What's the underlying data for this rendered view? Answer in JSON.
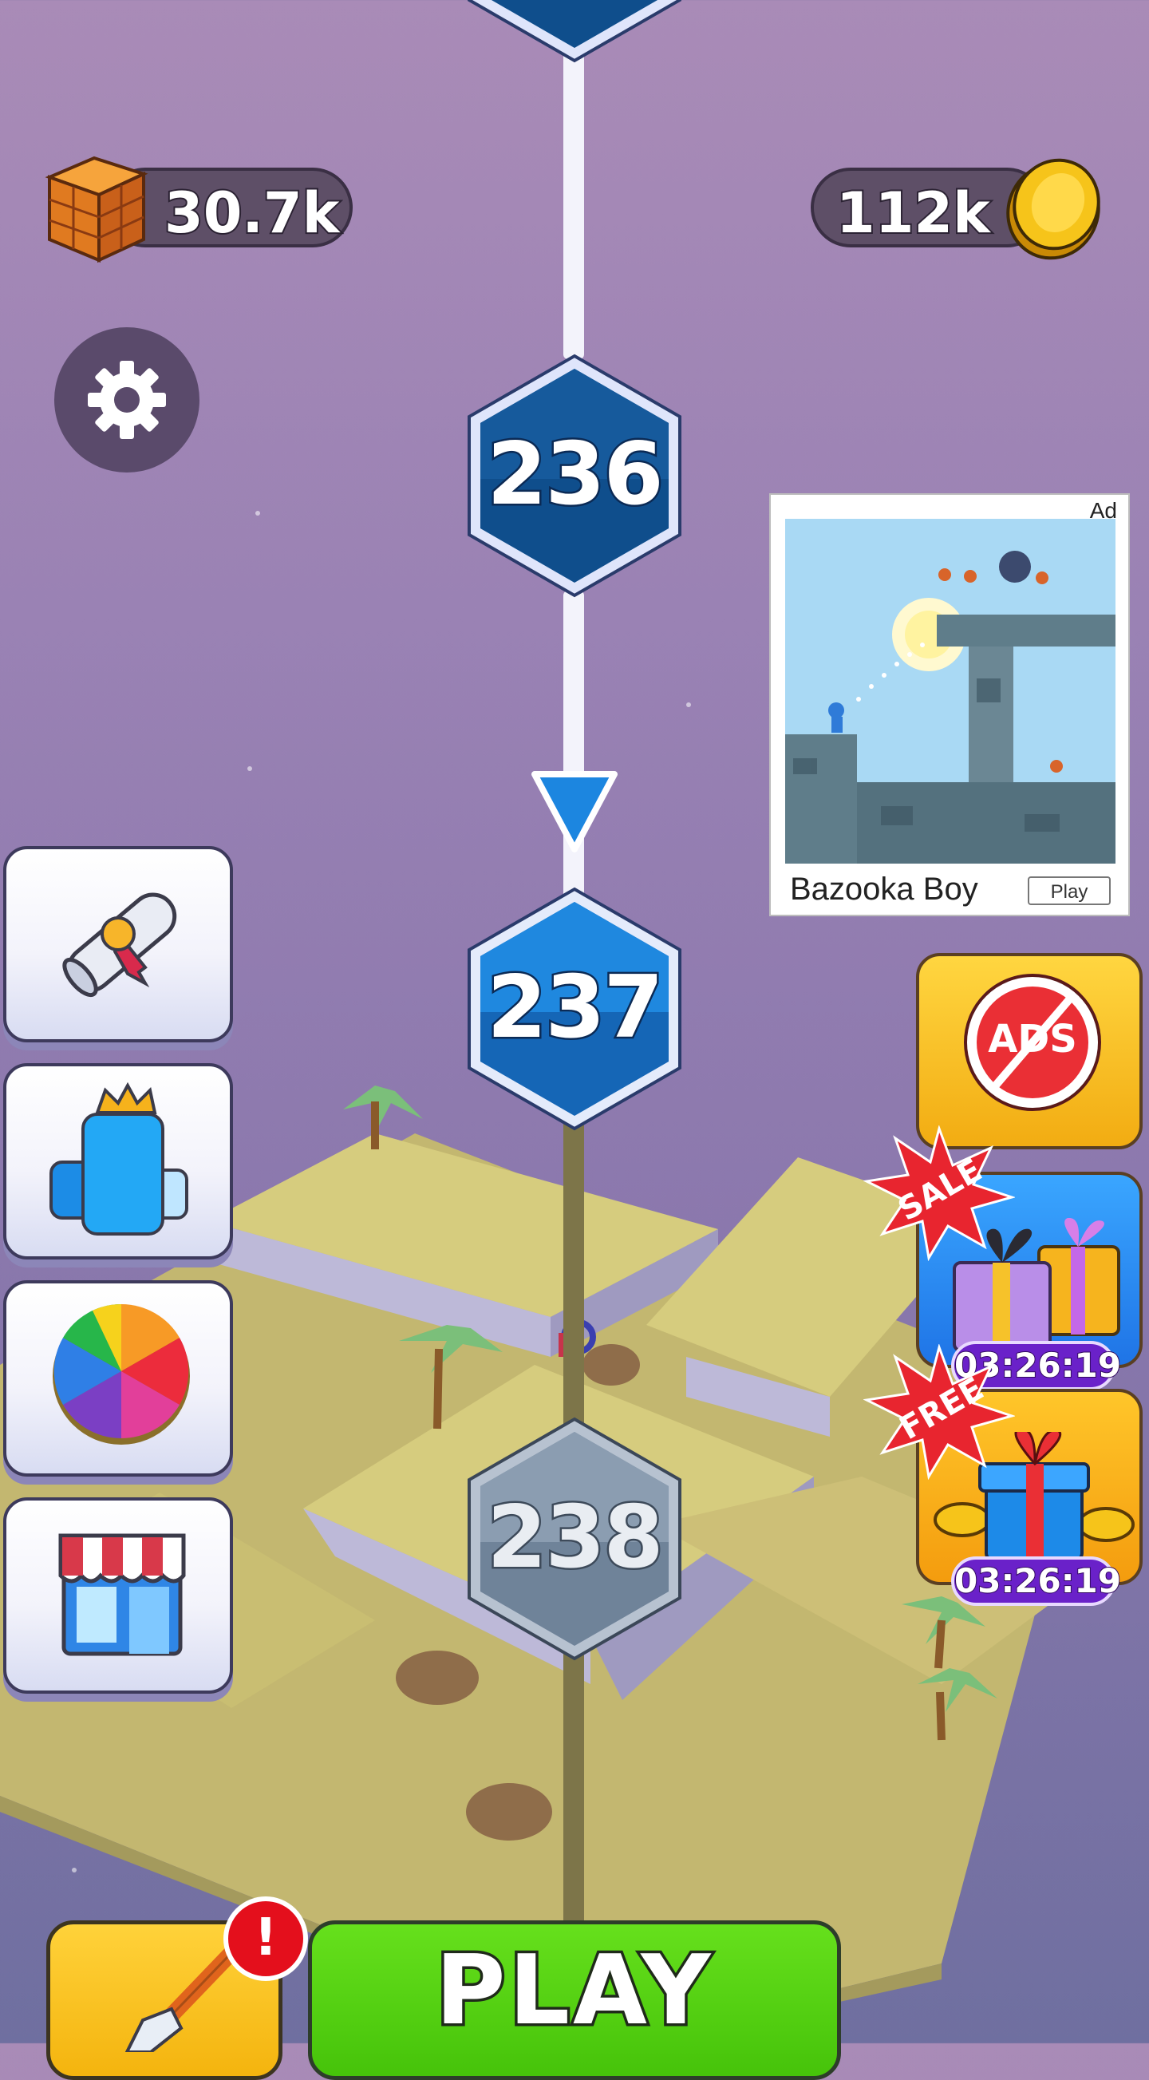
{
  "currency": {
    "bricks": {
      "icon": "brick-crate-icon",
      "value": "30.7k"
    },
    "coins": {
      "icon": "gold-coin-icon",
      "value": "112k"
    }
  },
  "settings": {
    "icon": "gear-icon"
  },
  "levels": [
    {
      "number": "236",
      "state": "completed"
    },
    {
      "number": "237",
      "state": "current"
    },
    {
      "number": "238",
      "state": "locked"
    }
  ],
  "left_menu": [
    {
      "name": "certificate-scroll-button",
      "icon": "scroll-ribbon-icon"
    },
    {
      "name": "king-skin-button",
      "icon": "crowned-block-icon"
    },
    {
      "name": "spin-wheel-button",
      "icon": "color-wheel-icon"
    },
    {
      "name": "shop-button",
      "icon": "storefront-icon"
    }
  ],
  "ad": {
    "tag": "Ad",
    "title": "Bazooka Boy",
    "cta": "Play"
  },
  "right_menu": {
    "no_ads": {
      "label": "ADS",
      "icon": "no-ads-icon"
    },
    "sale": {
      "badge": "SALE",
      "icon": "gift-boxes-icon",
      "timer": "03:26:19"
    },
    "free": {
      "badge": "FREE",
      "icon": "gift-coins-icon",
      "timer": "03:26:19"
    }
  },
  "bottom": {
    "play_label": "PLAY",
    "dig": {
      "icon": "shovel-icon",
      "alert": "!"
    }
  },
  "colors": {
    "bg_top": "#a98bb7",
    "bg_bottom": "#6f6fa0",
    "level_current": "#1a7fd6",
    "level_completed": "#0f4e8c",
    "level_locked": "#7f93a8",
    "play_green": "#55d012",
    "accent_yellow": "#f8c21c",
    "timer_purple": "#6a21c9"
  }
}
